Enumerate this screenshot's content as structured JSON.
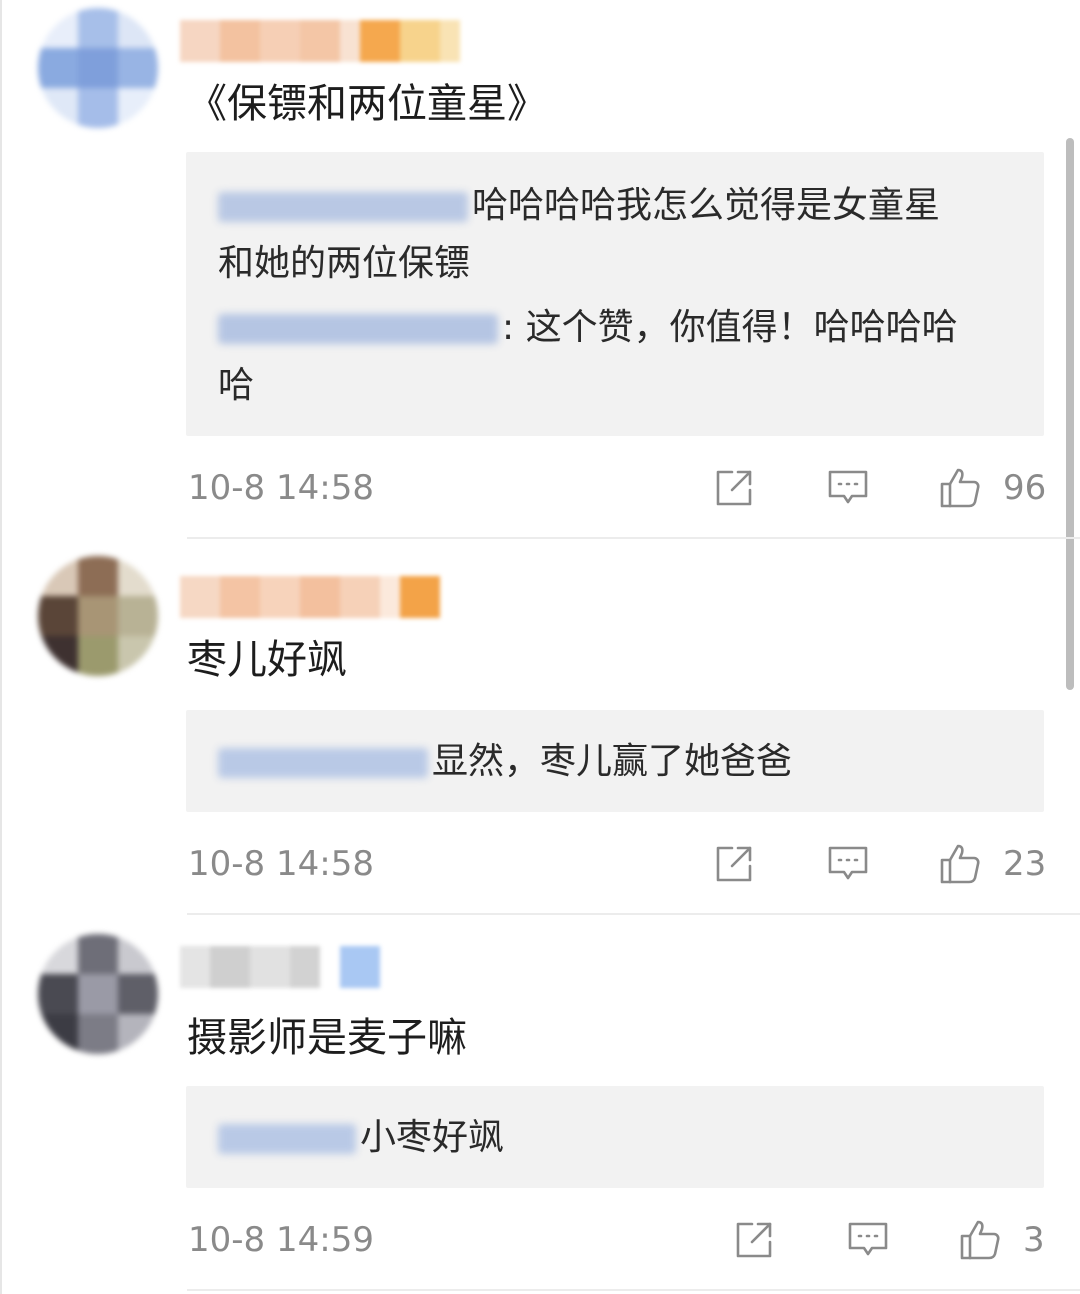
{
  "colors": {
    "reply_bg": "#f2f2f2",
    "meta_gray": "#8a8a8a",
    "blurred_name_blue": "#b7c7e6"
  },
  "comments": [
    {
      "text": "《保镖和两位童星》",
      "replies": [
        {
          "text": "哈哈哈哈我怎么觉得是女童星"
        },
        {
          "text": "和她的两位保镖"
        },
        {
          "text": ": 这个赞，你值得！哈哈哈哈"
        },
        {
          "text": "哈"
        }
      ],
      "time": "10-8 14:58",
      "likes": "96",
      "icons": [
        "share-icon",
        "comment-icon",
        "like-icon"
      ]
    },
    {
      "text": "枣儿好飒",
      "replies": [
        {
          "text": "显然，枣儿赢了她爸爸"
        }
      ],
      "time": "10-8 14:58",
      "likes": "23",
      "icons": [
        "share-icon",
        "comment-icon",
        "like-icon"
      ]
    },
    {
      "text": "摄影师是麦子嘛",
      "replies": [
        {
          "text": "小枣好飒"
        }
      ],
      "time": "10-8 14:59",
      "likes": "3",
      "icons": [
        "share-icon",
        "comment-icon",
        "like-icon"
      ]
    }
  ]
}
